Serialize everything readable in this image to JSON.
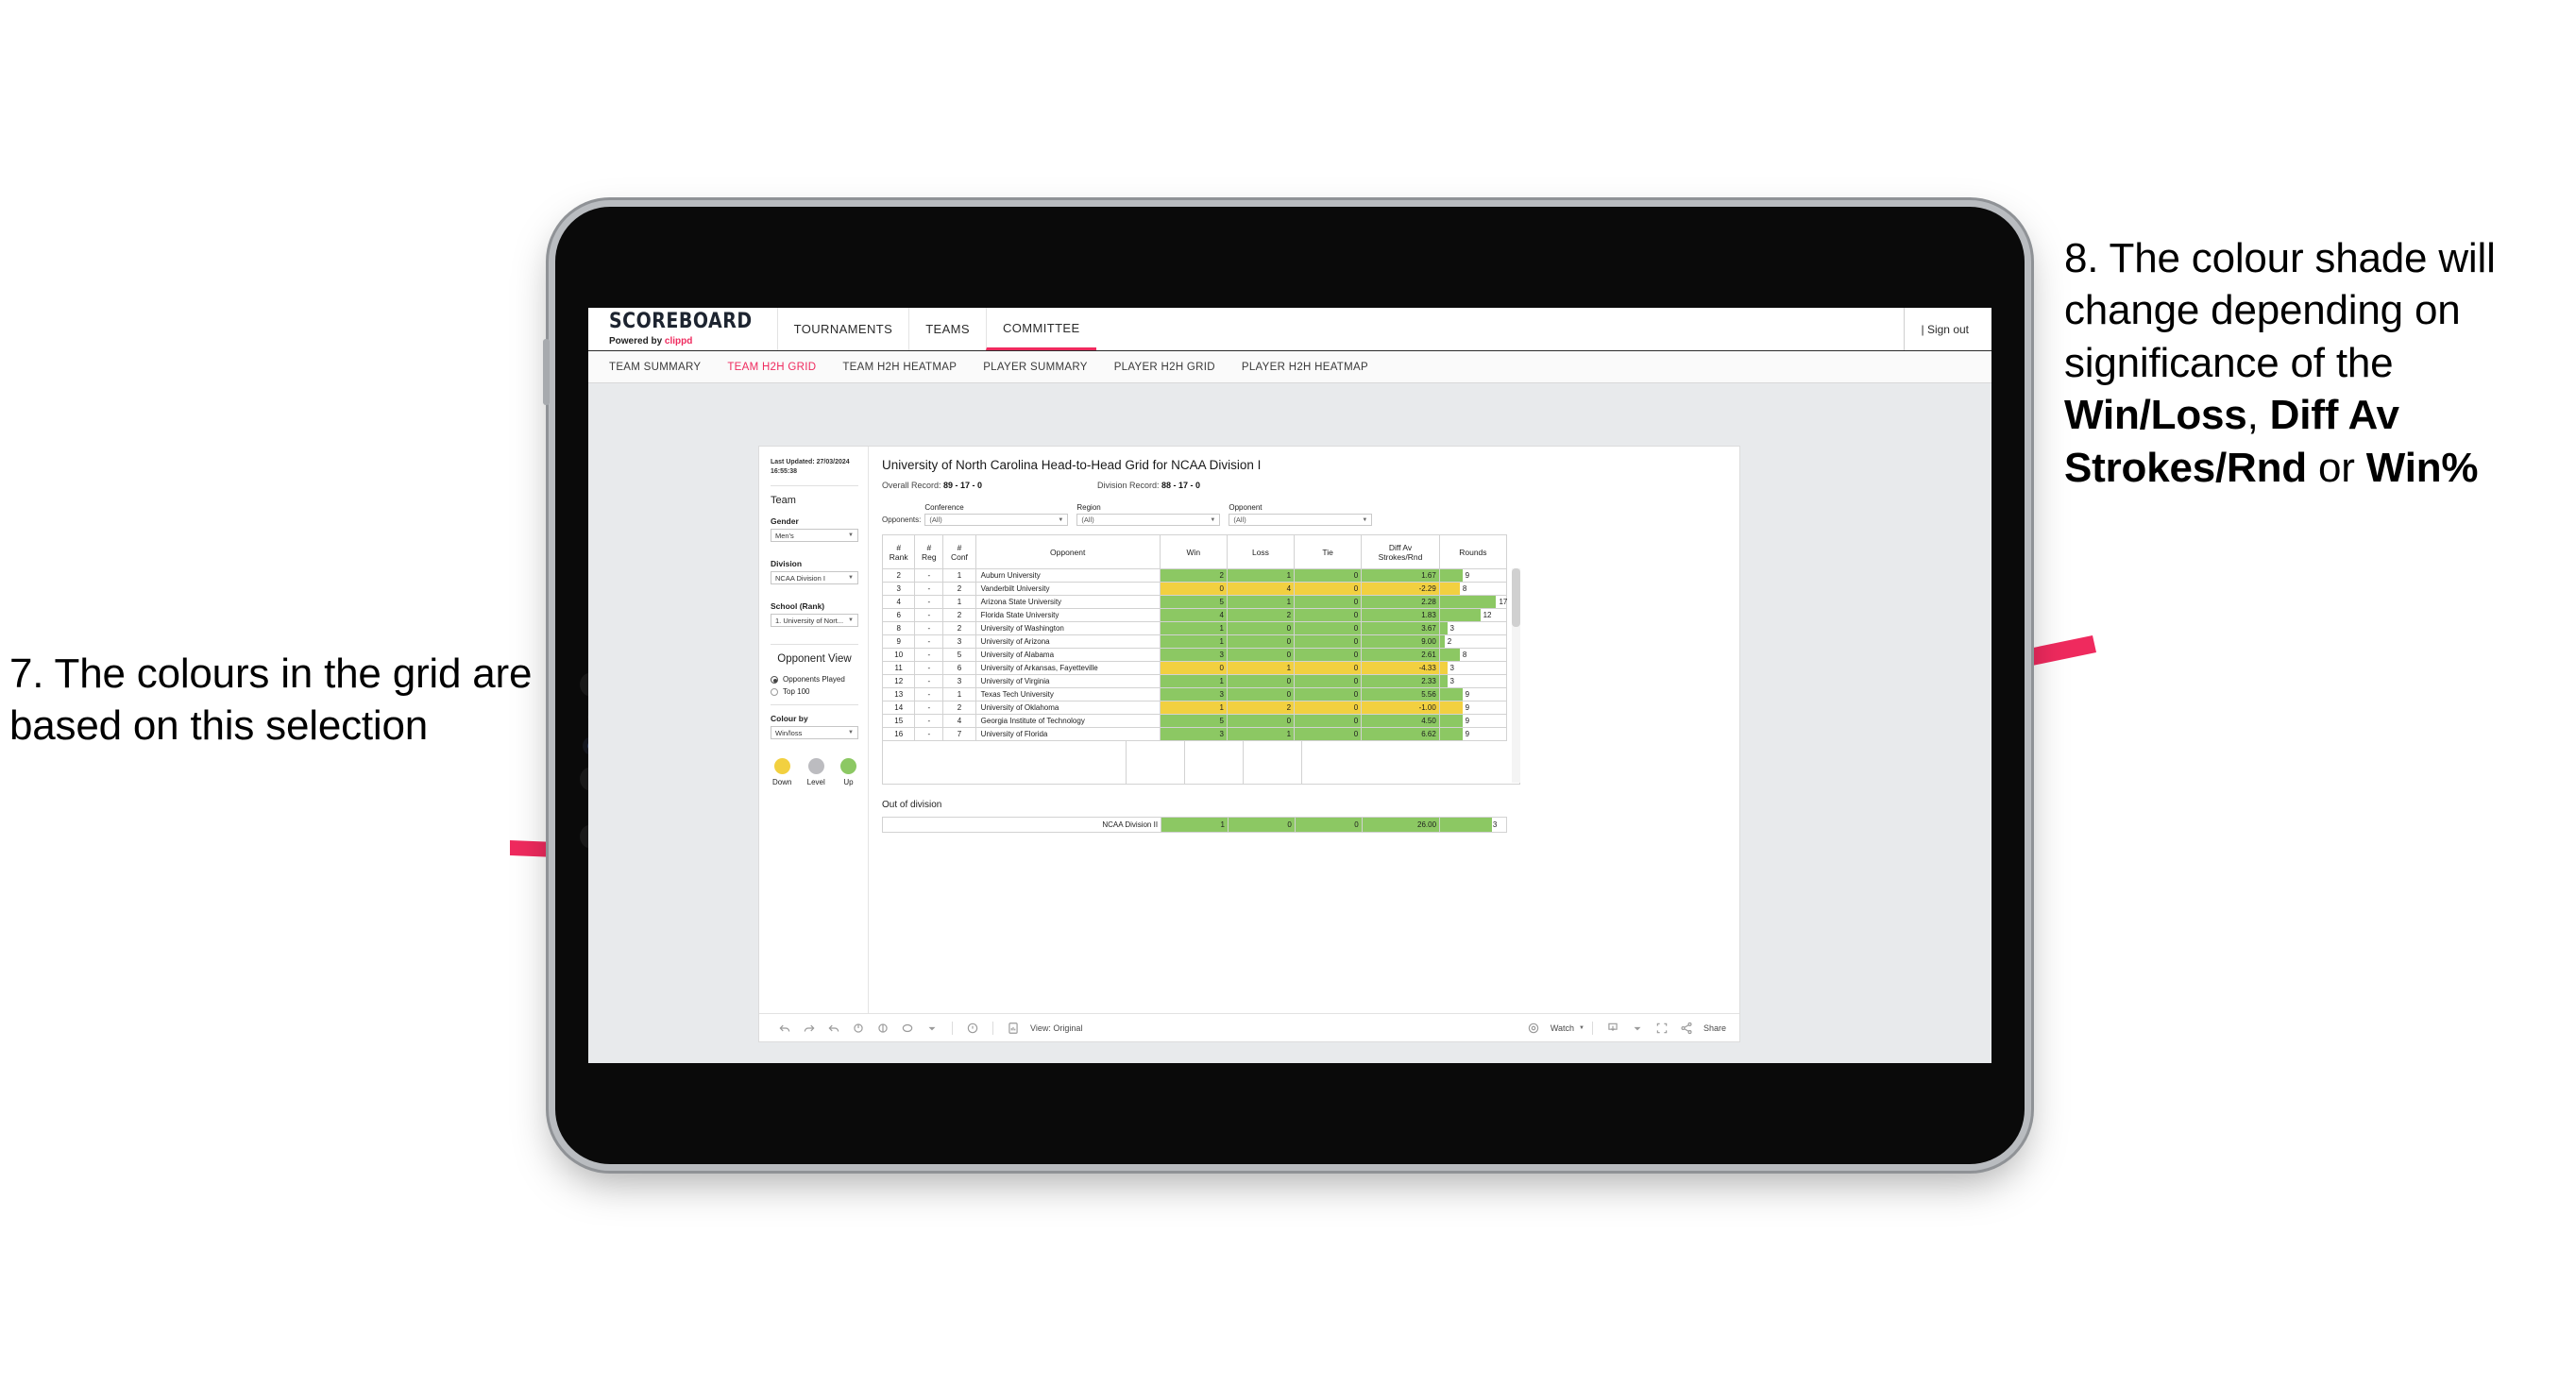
{
  "annotations": {
    "left": {
      "number": "7.",
      "text": "7. The colours in the grid are based on this selection"
    },
    "right": {
      "prefix": "8. The colour shade will change depending on significance of the ",
      "bold1": "Win/Loss",
      "mid1": ", ",
      "bold2": "Diff Av Strokes/Rnd",
      "mid2": " or ",
      "bold3": "Win%"
    },
    "arrow_color": "#ef2a5e"
  },
  "app": {
    "brand": {
      "title": "SCOREBOARD",
      "powered_by": "Powered by ",
      "vendor": "clippd"
    },
    "top_nav": [
      {
        "label": "TOURNAMENTS",
        "active": false
      },
      {
        "label": "TEAMS",
        "active": false
      },
      {
        "label": "COMMITTEE",
        "active": true
      }
    ],
    "sign_out": "| Sign out",
    "sub_nav": [
      {
        "label": "TEAM SUMMARY",
        "active": false
      },
      {
        "label": "TEAM H2H GRID",
        "active": true
      },
      {
        "label": "TEAM H2H HEATMAP",
        "active": false
      },
      {
        "label": "PLAYER SUMMARY",
        "active": false
      },
      {
        "label": "PLAYER H2H GRID",
        "active": false
      },
      {
        "label": "PLAYER H2H HEATMAP",
        "active": false
      }
    ]
  },
  "sidebar": {
    "last_updated": "Last Updated: 27/03/2024 16:55:38",
    "team_heading": "Team",
    "gender": {
      "label": "Gender",
      "value": "Men's"
    },
    "division": {
      "label": "Division",
      "value": "NCAA Division I"
    },
    "school": {
      "label": "School (Rank)",
      "value": "1. University of Nort..."
    },
    "opponent_view": {
      "heading": "Opponent View",
      "options": [
        {
          "label": "Opponents Played",
          "selected": true
        },
        {
          "label": "Top 100",
          "selected": false
        }
      ]
    },
    "colour_by": {
      "label": "Colour by",
      "value": "Win/loss"
    },
    "legend": [
      {
        "label": "Down",
        "color": "#f2d040"
      },
      {
        "label": "Level",
        "color": "#bcbcc0"
      },
      {
        "label": "Up",
        "color": "#8cc863"
      }
    ]
  },
  "main": {
    "title": "University of North Carolina Head-to-Head Grid for NCAA Division I",
    "overall_record_label": "Overall Record: ",
    "overall_record_value": "89 - 17 - 0",
    "division_record_label": "Division Record: ",
    "division_record_value": "88 - 17 - 0",
    "opponents_label": "Opponents:",
    "filters": [
      {
        "label": "Conference",
        "value": "(All)"
      },
      {
        "label": "Region",
        "value": "(All)"
      },
      {
        "label": "Opponent",
        "value": "(All)"
      }
    ],
    "columns": [
      {
        "line1": "#",
        "line2": "Rank"
      },
      {
        "line1": "#",
        "line2": "Reg"
      },
      {
        "line1": "#",
        "line2": "Conf"
      },
      {
        "line1": "",
        "line2": "Opponent"
      },
      {
        "line1": "",
        "line2": "Win"
      },
      {
        "line1": "",
        "line2": "Loss"
      },
      {
        "line1": "",
        "line2": "Tie"
      },
      {
        "line1": "Diff Av",
        "line2": "Strokes/Rnd"
      },
      {
        "line1": "",
        "line2": "Rounds"
      }
    ],
    "rows": [
      {
        "rank": "2",
        "reg": "-",
        "conf": "1",
        "opponent": "Auburn University",
        "win": "2",
        "loss": "1",
        "tie": "0",
        "diff": "1.67",
        "rounds": "9",
        "bar": 34,
        "color": "#8cc863"
      },
      {
        "rank": "3",
        "reg": "-",
        "conf": "2",
        "opponent": "Vanderbilt University",
        "win": "0",
        "loss": "4",
        "tie": "0",
        "diff": "-2.29",
        "rounds": "8",
        "bar": 30,
        "color": "#f2d040"
      },
      {
        "rank": "4",
        "reg": "-",
        "conf": "1",
        "opponent": "Arizona State University",
        "win": "5",
        "loss": "1",
        "tie": "0",
        "diff": "2.28",
        "rounds": "17",
        "bar": 85,
        "color": "#8cc863"
      },
      {
        "rank": "6",
        "reg": "-",
        "conf": "2",
        "opponent": "Florida State University",
        "win": "4",
        "loss": "2",
        "tie": "0",
        "diff": "1.83",
        "rounds": "12",
        "bar": 61,
        "color": "#8cc863"
      },
      {
        "rank": "8",
        "reg": "-",
        "conf": "2",
        "opponent": "University of Washington",
        "win": "1",
        "loss": "0",
        "tie": "0",
        "diff": "3.67",
        "rounds": "3",
        "bar": 11,
        "color": "#8cc863"
      },
      {
        "rank": "9",
        "reg": "-",
        "conf": "3",
        "opponent": "University of Arizona",
        "win": "1",
        "loss": "0",
        "tie": "0",
        "diff": "9.00",
        "rounds": "2",
        "bar": 7,
        "color": "#8cc863"
      },
      {
        "rank": "10",
        "reg": "-",
        "conf": "5",
        "opponent": "University of Alabama",
        "win": "3",
        "loss": "0",
        "tie": "0",
        "diff": "2.61",
        "rounds": "8",
        "bar": 30,
        "color": "#8cc863"
      },
      {
        "rank": "11",
        "reg": "-",
        "conf": "6",
        "opponent": "University of Arkansas, Fayetteville",
        "win": "0",
        "loss": "1",
        "tie": "0",
        "diff": "-4.33",
        "rounds": "3",
        "bar": 11,
        "color": "#f2d040"
      },
      {
        "rank": "12",
        "reg": "-",
        "conf": "3",
        "opponent": "University of Virginia",
        "win": "1",
        "loss": "0",
        "tie": "0",
        "diff": "2.33",
        "rounds": "3",
        "bar": 11,
        "color": "#8cc863"
      },
      {
        "rank": "13",
        "reg": "-",
        "conf": "1",
        "opponent": "Texas Tech University",
        "win": "3",
        "loss": "0",
        "tie": "0",
        "diff": "5.56",
        "rounds": "9",
        "bar": 34,
        "color": "#8cc863"
      },
      {
        "rank": "14",
        "reg": "-",
        "conf": "2",
        "opponent": "University of Oklahoma",
        "win": "1",
        "loss": "2",
        "tie": "0",
        "diff": "-1.00",
        "rounds": "9",
        "bar": 34,
        "color": "#f2d040"
      },
      {
        "rank": "15",
        "reg": "-",
        "conf": "4",
        "opponent": "Georgia Institute of Technology",
        "win": "5",
        "loss": "0",
        "tie": "0",
        "diff": "4.50",
        "rounds": "9",
        "bar": 34,
        "color": "#8cc863"
      },
      {
        "rank": "16",
        "reg": "-",
        "conf": "7",
        "opponent": "University of Florida",
        "win": "3",
        "loss": "1",
        "tie": "0",
        "diff": "6.62",
        "rounds": "9",
        "bar": 34,
        "color": "#8cc863"
      }
    ],
    "out_of_division": {
      "title": "Out of division",
      "row": {
        "opponent": "NCAA Division II",
        "win": "1",
        "loss": "0",
        "tie": "0",
        "diff": "26.00",
        "rounds": "3",
        "bar": 78,
        "color": "#8cc863"
      }
    }
  },
  "toolbar": {
    "icons": [
      "undo-icon",
      "redo-icon",
      "revert-icon",
      "refresh-icon",
      "pause-icon",
      "alerts-icon",
      "custom-views-icon"
    ],
    "view_label": "View: Original",
    "watch_label": "Watch",
    "share_label": "Share"
  },
  "chart_data": {
    "type": "table",
    "title": "University of North Carolina Head-to-Head Grid for NCAA Division I",
    "columns": [
      "# Rank",
      "# Reg",
      "# Conf",
      "Opponent",
      "Win",
      "Loss",
      "Tie",
      "Diff Av Strokes/Rnd",
      "Rounds"
    ],
    "colour_encoding": "Win/loss",
    "colour_scale": {
      "Down": "#f2d040",
      "Level": "#bcbcc0",
      "Up": "#8cc863"
    },
    "rows": [
      [
        "2",
        "-",
        "1",
        "Auburn University",
        2,
        1,
        0,
        1.67,
        9
      ],
      [
        "3",
        "-",
        "2",
        "Vanderbilt University",
        0,
        4,
        0,
        -2.29,
        8
      ],
      [
        "4",
        "-",
        "1",
        "Arizona State University",
        5,
        1,
        0,
        2.28,
        17
      ],
      [
        "6",
        "-",
        "2",
        "Florida State University",
        4,
        2,
        0,
        1.83,
        12
      ],
      [
        "8",
        "-",
        "2",
        "University of Washington",
        1,
        0,
        0,
        3.67,
        3
      ],
      [
        "9",
        "-",
        "3",
        "University of Arizona",
        1,
        0,
        0,
        9.0,
        2
      ],
      [
        "10",
        "-",
        "5",
        "University of Alabama",
        3,
        0,
        0,
        2.61,
        8
      ],
      [
        "11",
        "-",
        "6",
        "University of Arkansas, Fayetteville",
        0,
        1,
        0,
        -4.33,
        3
      ],
      [
        "12",
        "-",
        "3",
        "University of Virginia",
        1,
        0,
        0,
        2.33,
        3
      ],
      [
        "13",
        "-",
        "1",
        "Texas Tech University",
        3,
        0,
        0,
        5.56,
        9
      ],
      [
        "14",
        "-",
        "2",
        "University of Oklahoma",
        1,
        2,
        0,
        -1.0,
        9
      ],
      [
        "15",
        "-",
        "4",
        "Georgia Institute of Technology",
        5,
        0,
        0,
        4.5,
        9
      ],
      [
        "16",
        "-",
        "7",
        "University of Florida",
        3,
        1,
        0,
        6.62,
        9
      ]
    ],
    "out_of_division_rows": [
      [
        "NCAA Division II",
        1,
        0,
        0,
        26.0,
        3
      ]
    ],
    "overall_record": "89 - 17 - 0",
    "division_record": "88 - 17 - 0"
  }
}
